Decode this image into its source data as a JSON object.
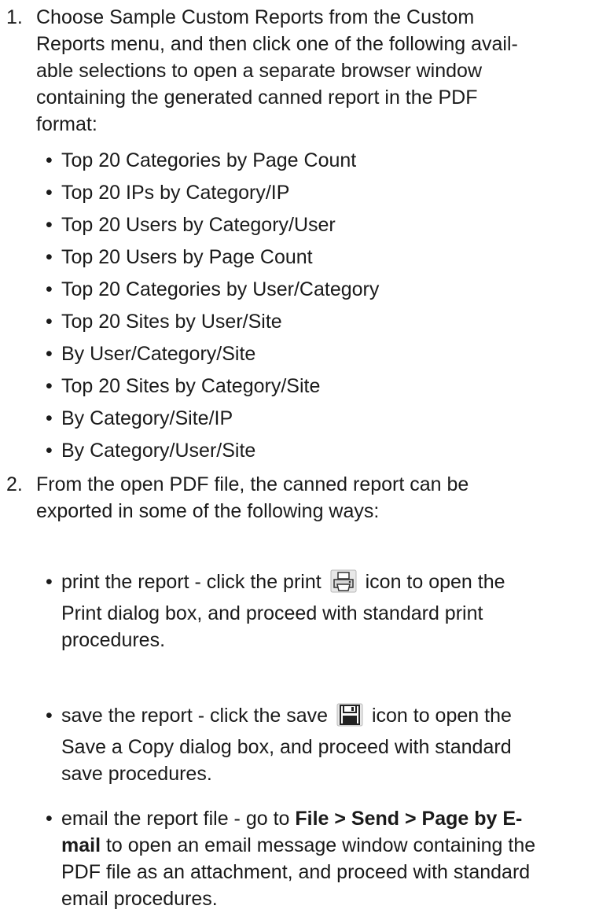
{
  "step1": {
    "number": "1.",
    "lines": "Choose Sample Custom Reports from the Custom\nReports menu, and then click one of the following avail-\nable selections to open a separate browser window\ncontaining the generated canned report in the PDF\nformat:",
    "reports": [
      "Top 20 Categories by Page Count",
      "Top 20 IPs by Category/IP",
      "Top 20 Users by Category/User",
      "Top 20 Users by Page Count",
      "Top 20 Categories by User/Category",
      "Top 20 Sites by User/Site",
      "By User/Category/Site",
      "Top 20 Sites by Category/Site",
      "By Category/Site/IP",
      "By Category/User/Site"
    ]
  },
  "step2": {
    "number": "2.",
    "lines": "From the open PDF file, the canned report can be\nexported in some of the following ways:",
    "print": {
      "pre": "print the report - click the print",
      "post": "icon to open the",
      "rest": "Print dialog box, and proceed with standard print\nprocedures.",
      "icon": "print-icon"
    },
    "save": {
      "pre": "save the report - click the save",
      "post": "icon to open the",
      "rest": "Save a Copy dialog box, and proceed with standard\nsave procedures.",
      "icon": "save-icon"
    },
    "email": {
      "pre": "email the report file - go to ",
      "bold1": "File > Send > Page by E-",
      "bold2": "mail",
      "rest1": " to open an email message window containing the",
      "rest2": "PDF file as an attachment, and proceed with standard\nemail procedures."
    }
  },
  "bullet_glyph": "•"
}
